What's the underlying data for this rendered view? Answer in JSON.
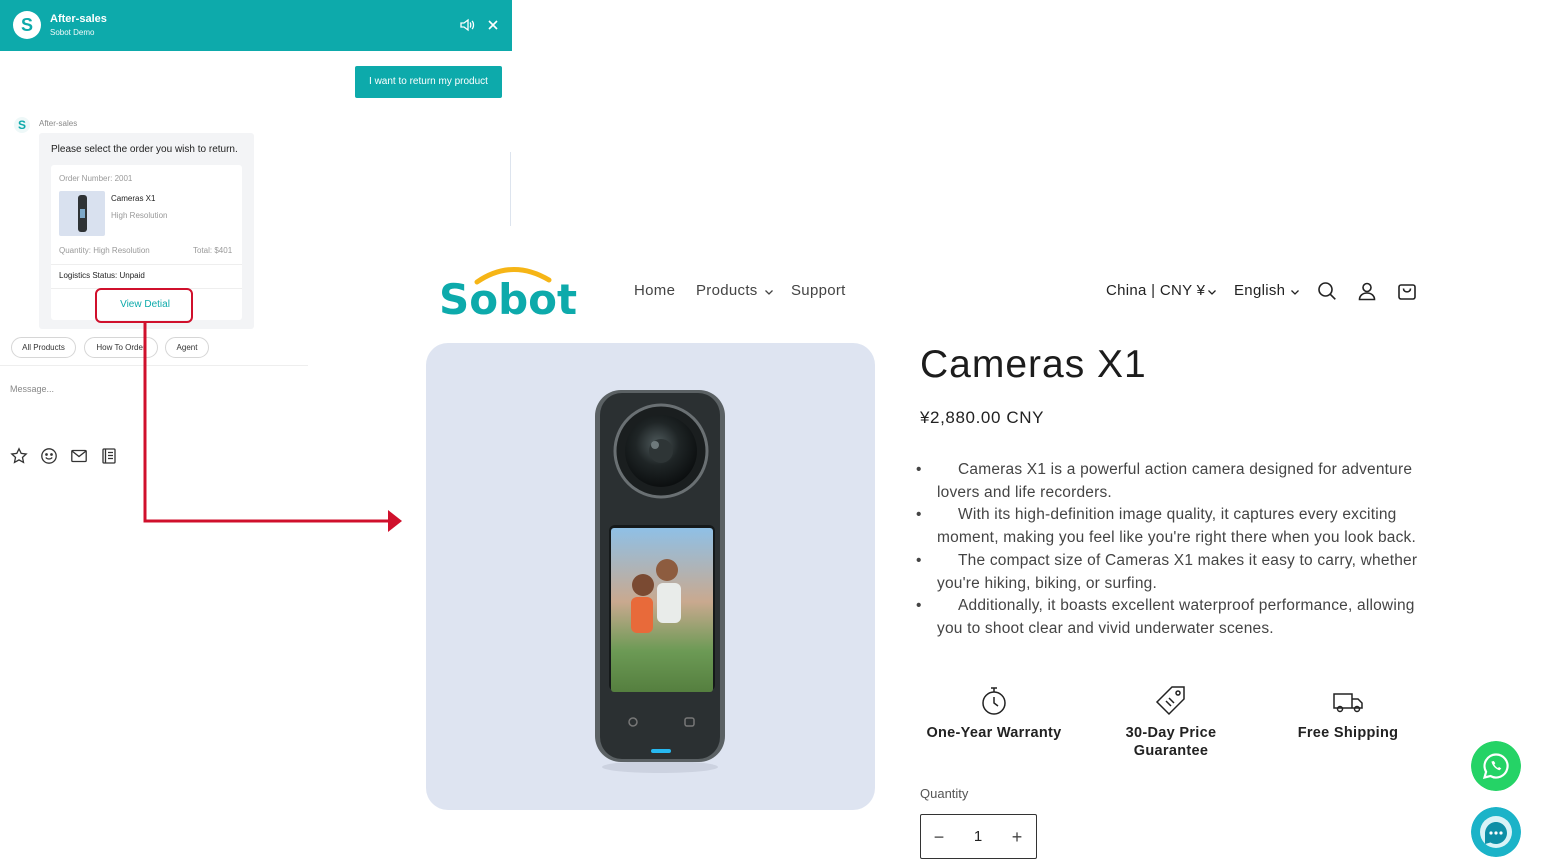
{
  "chat": {
    "header": {
      "title": "After-sales",
      "subtitle": "Sobot Demo"
    },
    "user_message": "I want to return my product",
    "bot_name": "After-sales",
    "bot_prompt": "Please select the order you wish to return.",
    "order": {
      "number": "Order Number: 2001",
      "product_name": "Cameras X1",
      "variant": "High Resolution",
      "quantity": "Quantity: High Resolution",
      "total": "Total: $401",
      "status": "Logistics Status: Unpaid",
      "view_detail": "View Detial"
    },
    "quick_replies": [
      "All Products",
      "How To Order",
      "Agent"
    ],
    "input_placeholder": "Message...",
    "toolbar_icons": [
      "star-icon",
      "emoji-icon",
      "mail-icon",
      "notes-icon"
    ]
  },
  "shop": {
    "nav": [
      "Home",
      "Products",
      "Support"
    ],
    "region": "China | CNY ¥",
    "language": "English",
    "product": {
      "title": "Cameras X1",
      "price": "¥2,880.00 CNY",
      "bullets": [
        "Cameras X1 is a powerful action camera designed for adventure lovers and life recorders.",
        "With its high-definition image quality, it captures every exciting moment, making you feel like you're right there when you look back.",
        "The compact size of Cameras X1 makes it easy to carry, whether you're hiking, biking, or surfing.",
        "Additionally, it boasts excellent waterproof performance, allowing you to shoot clear and vivid underwater scenes."
      ],
      "features": [
        {
          "label": "One-Year Warranty",
          "icon": "stopwatch-icon"
        },
        {
          "label": "30-Day Price Guarantee",
          "icon": "price-tag-icon"
        },
        {
          "label": "Free Shipping",
          "icon": "truck-icon"
        }
      ],
      "quantity_label": "Quantity",
      "quantity_value": "1"
    }
  },
  "colors": {
    "brand_teal": "#0daaab",
    "annotation_red": "#d0102c",
    "whatsapp_green": "#25d366",
    "chat_fab_blue": "#1bb3c8",
    "logo_yellow": "#f6b516"
  }
}
